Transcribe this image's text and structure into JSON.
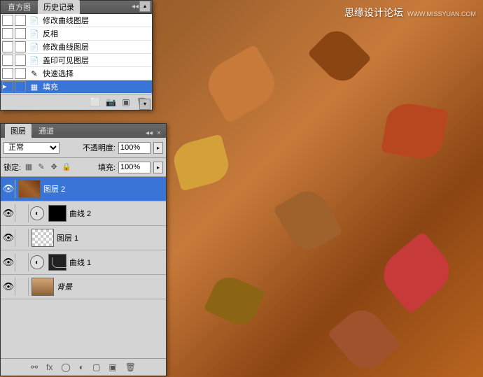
{
  "watermark": {
    "text": "思缘设计论坛",
    "url": "WWW.MISSYUAN.COM"
  },
  "history_panel": {
    "tabs": [
      "直方图",
      "历史记录"
    ],
    "active_tab": 1,
    "items": [
      {
        "icon": "📄",
        "label": "修改曲线图层",
        "selected": false
      },
      {
        "icon": "📄",
        "label": "反相",
        "selected": false
      },
      {
        "icon": "📄",
        "label": "修改曲线图层",
        "selected": false
      },
      {
        "icon": "📄",
        "label": "盖印可见图层",
        "selected": false
      },
      {
        "icon": "✎",
        "label": "快速选择",
        "selected": false
      },
      {
        "icon": "▦",
        "label": "填充",
        "selected": true
      }
    ]
  },
  "layers_panel": {
    "tabs": [
      "图层",
      "通道"
    ],
    "active_tab": 0,
    "blend_mode": "正常",
    "opacity_label": "不透明度:",
    "opacity_value": "100%",
    "lock_label": "锁定:",
    "fill_label": "填充:",
    "fill_value": "100%",
    "layers": [
      {
        "type": "image",
        "name": "图层 2",
        "selected": true,
        "thumb": "leaves"
      },
      {
        "type": "adj",
        "name": "曲线 2",
        "selected": false,
        "mask": "black"
      },
      {
        "type": "image",
        "name": "图层 1",
        "selected": false,
        "thumb": "trans"
      },
      {
        "type": "adj",
        "name": "曲线 1",
        "selected": false,
        "mask": "curve"
      },
      {
        "type": "bg",
        "name": "背景",
        "selected": false,
        "thumb": "bg"
      }
    ]
  }
}
